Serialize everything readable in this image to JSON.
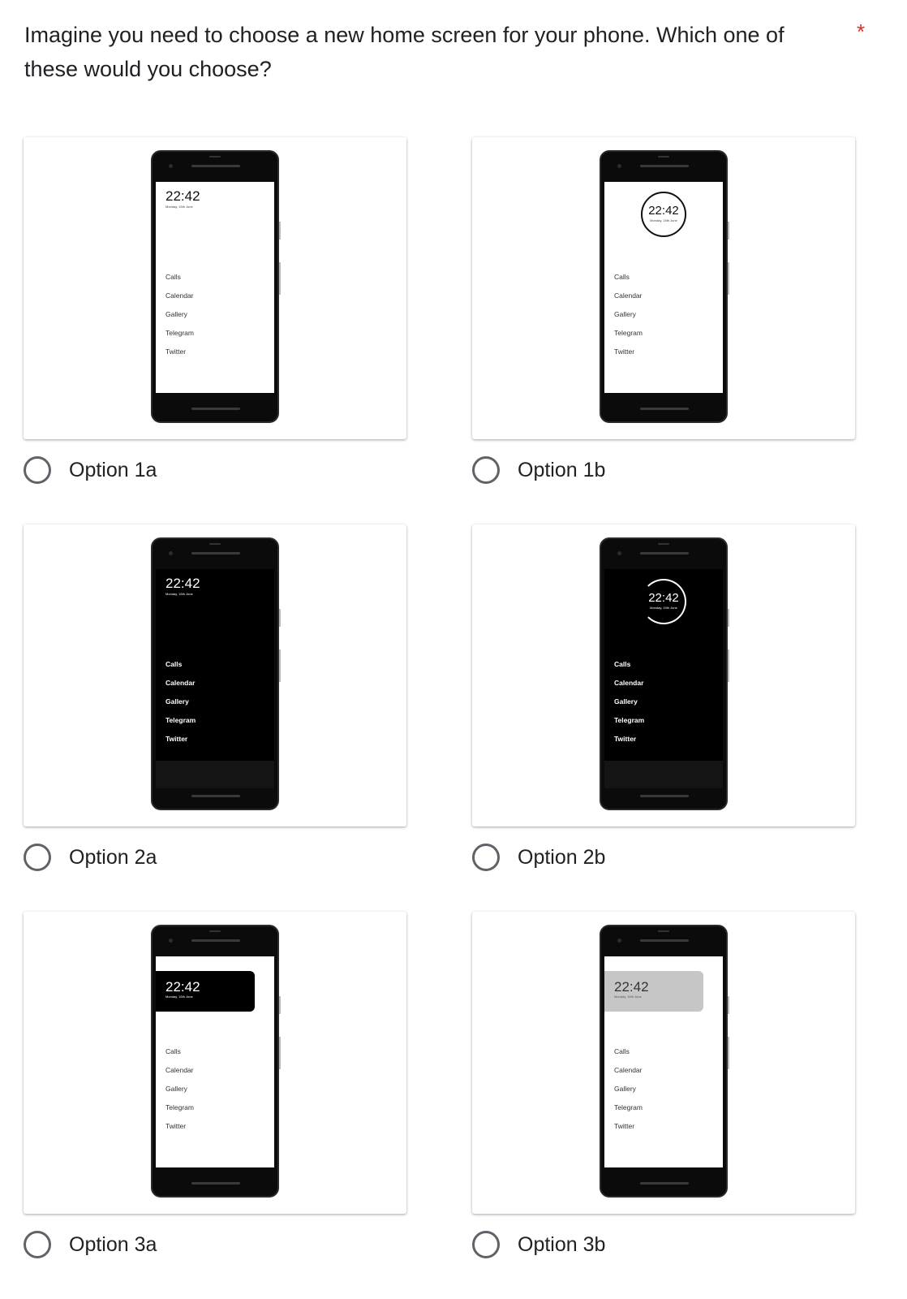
{
  "question": {
    "text": "Imagine you need to choose a new home screen for your phone. Which one of these would you choose?",
    "required_marker": "*"
  },
  "phone_content": {
    "time": "22:42",
    "date": "Monday, 15th June",
    "apps": [
      "Calls",
      "Calendar",
      "Gallery",
      "Telegram",
      "Twitter"
    ]
  },
  "options": [
    {
      "label": "Option 1a",
      "style": "plain-light",
      "selected": false
    },
    {
      "label": "Option 1b",
      "style": "ring-light",
      "selected": false
    },
    {
      "label": "Option 2a",
      "style": "plain-dark",
      "selected": false
    },
    {
      "label": "Option 2b",
      "style": "ring-dark",
      "selected": false
    },
    {
      "label": "Option 3a",
      "style": "widget-black",
      "selected": false
    },
    {
      "label": "Option 3b",
      "style": "widget-grey",
      "selected": false
    }
  ],
  "colors": {
    "required": "#d93025",
    "radio_border": "#5f6368",
    "text": "#202124"
  }
}
